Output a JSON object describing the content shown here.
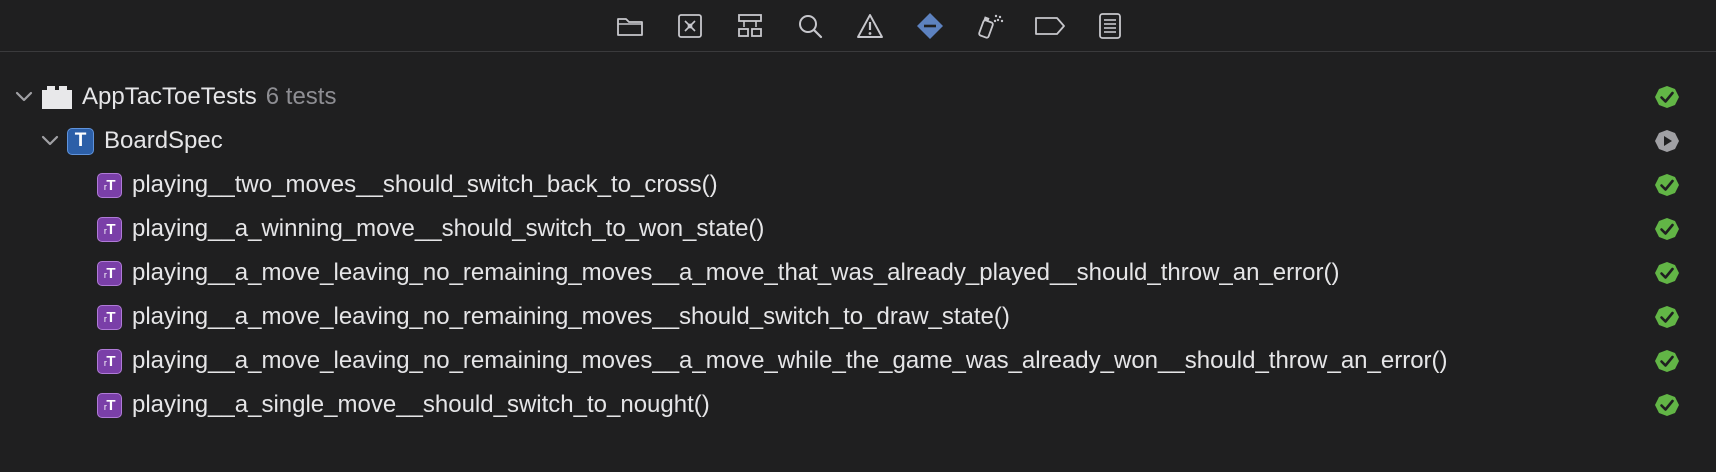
{
  "toolbar": {
    "icons": [
      "folder-icon",
      "source-control-icon",
      "hierarchy-icon",
      "search-icon",
      "warning-icon",
      "test-navigator-icon",
      "debug-icon",
      "breakpoint-icon",
      "report-icon"
    ],
    "active": "test-navigator-icon"
  },
  "tree": {
    "bundle": {
      "label": "AppTacToeTests",
      "count": "6 tests",
      "status": "passed"
    },
    "class": {
      "icon_letter": "T",
      "label": "BoardSpec",
      "status": "run"
    },
    "method_icon": {
      "small": "r",
      "large": "T"
    },
    "methods": [
      {
        "label": "playing__two_moves__should_switch_back_to_cross()",
        "status": "passed"
      },
      {
        "label": "playing__a_winning_move__should_switch_to_won_state()",
        "status": "passed"
      },
      {
        "label": "playing__a_move_leaving_no_remaining_moves__a_move_that_was_already_played__should_throw_an_error()",
        "status": "passed"
      },
      {
        "label": "playing__a_move_leaving_no_remaining_moves__should_switch_to_draw_state()",
        "status": "passed"
      },
      {
        "label": "playing__a_move_leaving_no_remaining_moves__a_move_while_the_game_was_already_won__should_throw_an_error()",
        "status": "passed"
      },
      {
        "label": "playing__a_single_move__should_switch_to_nought()",
        "status": "passed"
      }
    ]
  },
  "colors": {
    "background": "#1f1f20",
    "passed": "#62b546",
    "run": "#a0a0a4",
    "active_icon": "#5d82c0",
    "icon": "#c7c7cc"
  }
}
